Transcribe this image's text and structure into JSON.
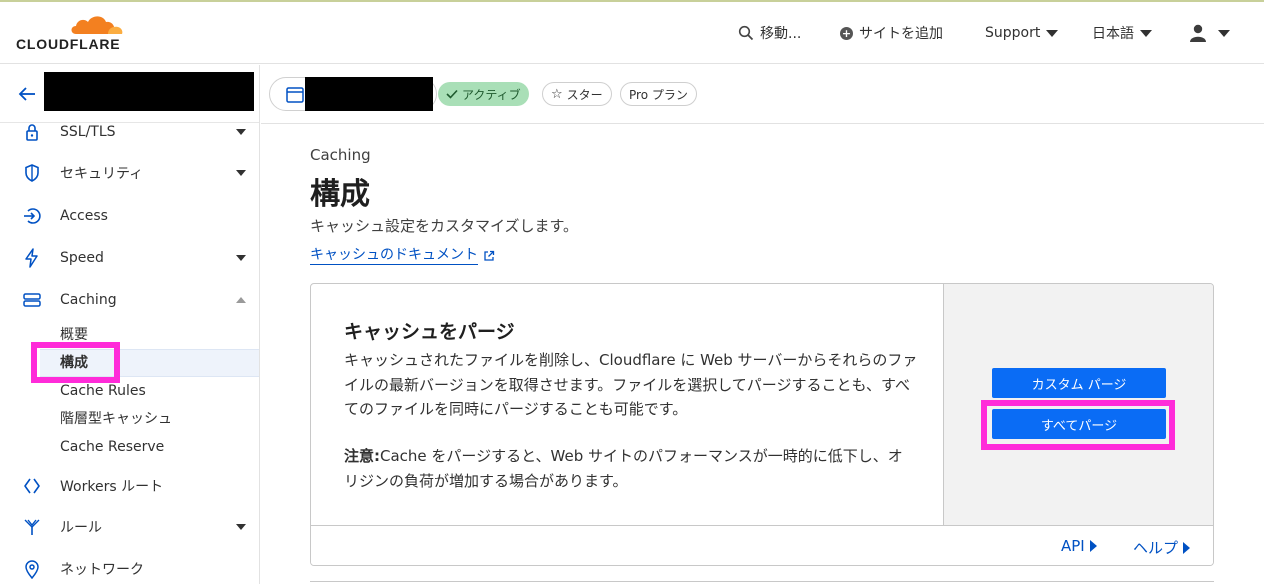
{
  "header": {
    "logo_text": "CLOUDFLARE",
    "search_label": "移動...",
    "add_site_label": "サイトを追加",
    "support_label": "Support",
    "language_label": "日本語"
  },
  "sidebar": {
    "items": [
      {
        "label": "SSL/TLS",
        "icon": "lock-icon"
      },
      {
        "label": "セキュリティ",
        "icon": "shield-icon"
      },
      {
        "label": "Access",
        "icon": "access-icon"
      },
      {
        "label": "Speed",
        "icon": "lightning-icon"
      },
      {
        "label": "Caching",
        "icon": "caching-icon"
      }
    ],
    "caching_subitems": [
      "概要",
      "構成",
      "Cache Rules",
      "階層型キャッシュ",
      "Cache Reserve"
    ],
    "items_after": [
      {
        "label": "Workers ルート",
        "icon": "workers-icon"
      },
      {
        "label": "ルール",
        "icon": "rules-icon"
      },
      {
        "label": "ネットワーク",
        "icon": "location-pin-icon"
      }
    ]
  },
  "topbar": {
    "status_badge": "アクティブ",
    "star_label": "スター",
    "plan_label": "Pro プラン"
  },
  "main": {
    "breadcrumb": "Caching",
    "title": "構成",
    "description": "キャッシュ設定をカスタマイズします。",
    "doc_link": "キャッシュのドキュメント"
  },
  "purge_card": {
    "title": "キャッシュをパージ",
    "body": "キャッシュされたファイルを削除し、Cloudflare に Web サーバーからそれらのファイルの最新バージョンを取得させます。ファイルを選択してパージすることも、すべてのファイルを同時にパージすることも可能です。",
    "note_label": "注意:",
    "note_text": "Cache をパージすると、Web サイトのパフォーマンスが一時的に低下し、オリジンの負荷が増加する場合があります。",
    "custom_purge_button": "カスタム パージ",
    "purge_all_button": "すべてパージ",
    "api_link": "API",
    "help_link": "ヘルプ"
  },
  "colors": {
    "accent": "#0a6cf5",
    "link": "#0051c3",
    "highlight": "#ff2bd9",
    "active_badge": "#a9dfb7",
    "logo_orange": "#f38020"
  }
}
